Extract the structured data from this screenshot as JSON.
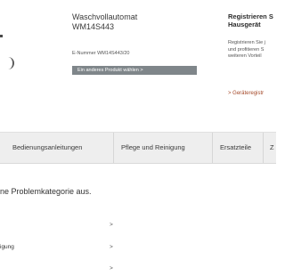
{
  "product": {
    "title": "Waschvollautomat",
    "model": "WM14S443",
    "enr": "E-Nummer WM14S443/20",
    "other_button": "Ein anderes Produkt wählen  >"
  },
  "register": {
    "title": "Registrieren S",
    "subtitle": "Hausgerät",
    "body_lines": [
      "Registrieren Sie j",
      "und profitieren S",
      "weiteren Vorteil"
    ],
    "link": "> Geräteregistr"
  },
  "tabs": [
    "Bedienungsanleitungen",
    "Pflege und Reinigung",
    "Ersatzteile",
    "Z"
  ],
  "main": {
    "heading": "ne Problemkategorie aus.",
    "categories": [
      {
        "label": "",
        "chevron": ">"
      },
      {
        "label": "igung",
        "chevron": ">"
      },
      {
        "label": "",
        "chevron": ">"
      }
    ]
  }
}
